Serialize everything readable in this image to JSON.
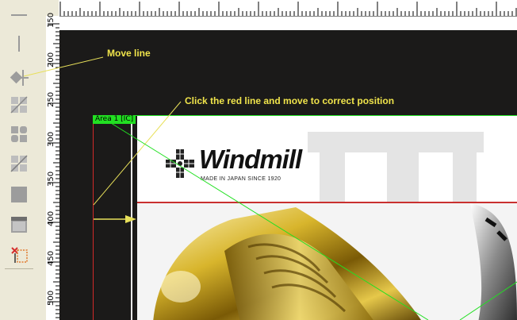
{
  "annotations": {
    "move_line": "Move line",
    "click_red_line": "Click the red line and move to correct position"
  },
  "ruler_left": {
    "labels": [
      "150",
      "200",
      "250",
      "300",
      "350",
      "400",
      "450",
      "500"
    ]
  },
  "area": {
    "label": "Area 1 [IC]"
  },
  "product": {
    "brand": "Windmill",
    "tagline": "MADE IN JAPAN SINCE 1920"
  },
  "toolbar": {
    "tools": [
      "horizontal-line-icon",
      "vertical-line-icon",
      "move-line-icon",
      "split-area-icon",
      "group-shapes-icon",
      "crop-icon",
      "fill-rect-icon",
      "window-icon",
      "delete-area-icon"
    ]
  },
  "colors": {
    "annotation": "#f0e44b",
    "area_border": "#22e022",
    "guide_red": "#c9302f",
    "dark_sheet": "#1b1a19"
  }
}
